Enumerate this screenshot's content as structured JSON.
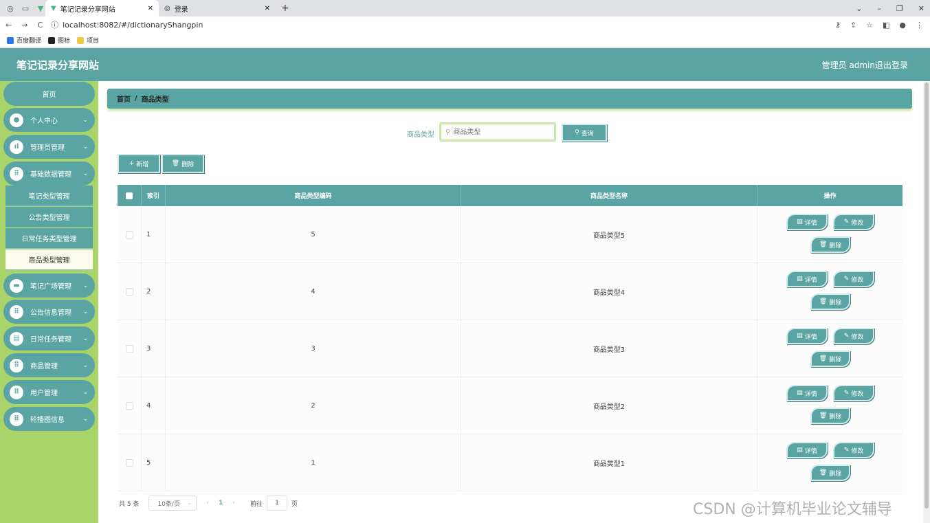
{
  "browser": {
    "tabs": [
      {
        "title": "笔记记录分享网站"
      },
      {
        "title": "登录"
      }
    ],
    "url": "localhost:8082/#/dictionaryShangpin",
    "bookmarks": [
      "百度翻译",
      "图标",
      "项目"
    ]
  },
  "header": {
    "site_title": "笔记记录分享网站",
    "user_label": "管理员 admin",
    "logout_label": "退出登录"
  },
  "sidebar": {
    "home": "首页",
    "items": [
      {
        "label": "个人中心"
      },
      {
        "label": "管理员管理"
      },
      {
        "label": "基础数据管理"
      },
      {
        "label": "笔记广场管理"
      },
      {
        "label": "公告信息管理"
      },
      {
        "label": "日常任务管理"
      },
      {
        "label": "商品管理"
      },
      {
        "label": "用户管理"
      },
      {
        "label": "轮播图信息"
      }
    ],
    "submenu": [
      {
        "label": "笔记类型管理"
      },
      {
        "label": "公告类型管理"
      },
      {
        "label": "日常任务类型管理"
      },
      {
        "label": "商品类型管理"
      }
    ]
  },
  "breadcrumb": {
    "home": "首页",
    "sep": "/",
    "current": "商品类型"
  },
  "search": {
    "label": "商品类型",
    "placeholder": "商品类型",
    "button": "查询"
  },
  "toolbar": {
    "add": "新增",
    "delete": "删除"
  },
  "table": {
    "headers": [
      "索引",
      "商品类型编码",
      "商品类型名称",
      "操作"
    ],
    "rows": [
      {
        "index": "1",
        "code": "5",
        "name": "商品类型5"
      },
      {
        "index": "2",
        "code": "4",
        "name": "商品类型4"
      },
      {
        "index": "3",
        "code": "3",
        "name": "商品类型3"
      },
      {
        "index": "4",
        "code": "2",
        "name": "商品类型2"
      },
      {
        "index": "5",
        "code": "1",
        "name": "商品类型1"
      }
    ],
    "actions": {
      "detail": "详情",
      "edit": "修改",
      "delete": "删除"
    }
  },
  "pager": {
    "total": "共 5 条",
    "page_size": "10条/页",
    "current_page": "1",
    "goto": "前往",
    "goto_value": "1",
    "page_unit": "页"
  },
  "watermark": "CSDN @计算机毕业论文辅导",
  "colors": {
    "primary": "#5aa5a3",
    "sidebar": "#a8d46a"
  }
}
